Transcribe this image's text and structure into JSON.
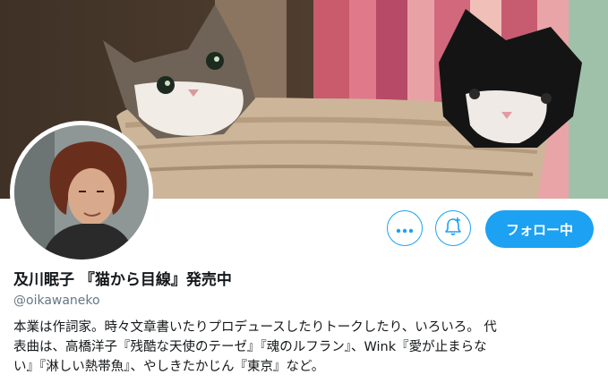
{
  "profile": {
    "name": "及川眠子 『猫から目線』発売中",
    "handle": "@oikawaneko",
    "bio_lines": [
      "本業は作詞家。時々文章書いたりプロデュースしたりトークしたり、いろいろ。 代",
      "表曲は、高橋洋子『残酷な天使のテーゼ』『魂のルフラン』、Wink『愛が止まらな",
      "い』『淋しい熱帯魚』、やしきたかじん『東京』など。"
    ]
  },
  "actions": {
    "follow_label": "フォロー中"
  },
  "icons": {
    "more": "more-dots-icon",
    "notify": "bell-plus-icon"
  },
  "colors": {
    "accent": "#1da1f2",
    "text": "#14171a",
    "muted": "#657786"
  }
}
